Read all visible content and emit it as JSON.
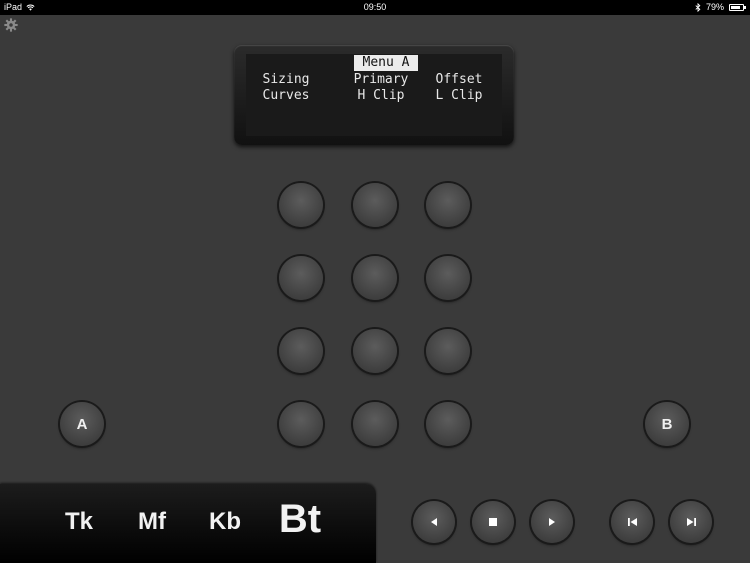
{
  "status_bar": {
    "device": "iPad",
    "time": "09:50",
    "battery_percent": "79%",
    "battery_level": 0.79
  },
  "lcd": {
    "title": "Menu A",
    "row1": [
      "Sizing",
      "Primary",
      "Offset"
    ],
    "row2": [
      "Curves",
      "H Clip",
      "L Clip"
    ]
  },
  "side_buttons": {
    "left": "A",
    "right": "B"
  },
  "modes": [
    "Tk",
    "Mf",
    "Kb",
    "Bt"
  ],
  "active_mode": "Bt",
  "transport": [
    "previous-icon",
    "stop-icon",
    "play-icon",
    "skip-back-icon",
    "skip-forward-icon"
  ],
  "icons": [
    "wifi-icon",
    "bluetooth-icon",
    "battery-icon",
    "gear-icon"
  ]
}
